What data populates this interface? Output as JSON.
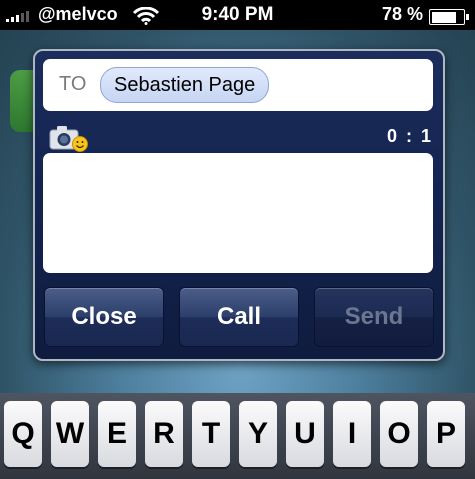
{
  "status_bar": {
    "carrier": "@melvco",
    "time": "9:40 PM",
    "battery_percent": "78 %",
    "battery_level": 0.78
  },
  "compose": {
    "to_label": "TO",
    "recipient": "Sebastien Page",
    "counter": "0 : 1",
    "message_text": "",
    "buttons": {
      "close": "Close",
      "call": "Call",
      "send": "Send"
    }
  },
  "keyboard": {
    "keys": [
      "Q",
      "W",
      "E",
      "R",
      "T",
      "Y",
      "U",
      "I",
      "O",
      "P"
    ]
  }
}
